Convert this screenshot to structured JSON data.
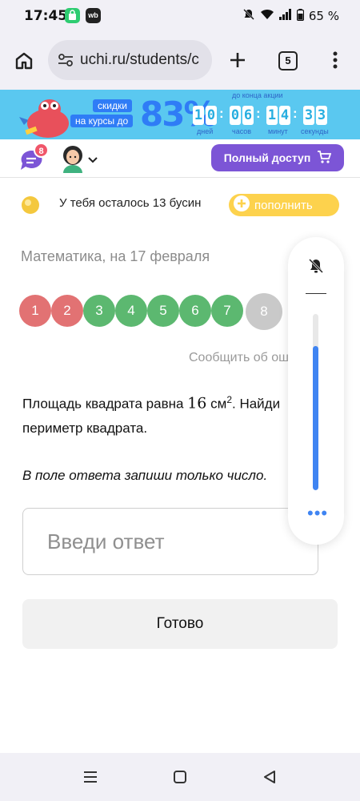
{
  "status_bar": {
    "time": "17:45",
    "app_icons": [
      {
        "icon": "shopping-bag-icon",
        "label": "",
        "color": "#2ecc71"
      },
      {
        "icon": "wildberries-icon",
        "label": "wb",
        "color": "#222222"
      }
    ],
    "icons": [
      "mute-icon",
      "wifi-icon",
      "signal-icon",
      "battery-icon"
    ],
    "battery": "65 %"
  },
  "browser": {
    "url": "uchi.ru/students/c",
    "tabs_count": "5"
  },
  "promo": {
    "tag_line1": "скидки",
    "tag_line2": "на курсы до",
    "percent": "83%",
    "until_label": "до конца акции",
    "timer": {
      "days": [
        "1",
        "0"
      ],
      "hours": [
        "0",
        "6"
      ],
      "minutes": [
        "1",
        "4"
      ],
      "seconds": [
        "3",
        "3"
      ]
    },
    "units": {
      "days": "дней",
      "hours": "часов",
      "minutes": "минут",
      "seconds": "секунды"
    }
  },
  "header": {
    "messages_badge": "8",
    "full_access_label": "Полный доступ"
  },
  "beads": {
    "text": "У тебя осталось 13 бусин",
    "topup_label": "пополнить"
  },
  "lesson_title": "Математика, на 17 февраля",
  "tasks": [
    {
      "n": "1",
      "status": "wrong"
    },
    {
      "n": "2",
      "status": "wrong"
    },
    {
      "n": "3",
      "status": "correct"
    },
    {
      "n": "4",
      "status": "correct"
    },
    {
      "n": "5",
      "status": "correct"
    },
    {
      "n": "6",
      "status": "correct"
    },
    {
      "n": "7",
      "status": "correct"
    },
    {
      "n": "8",
      "status": "current"
    }
  ],
  "task_colors": {
    "wrong": "#e27273",
    "correct": "#5cb870",
    "current": "#c9c9c9"
  },
  "report_link": "Сообщить об ошибке",
  "question": {
    "before": "Площадь квадрата равна ",
    "number": "16",
    "unit": " см",
    "exponent": "2",
    "after": ". Найди периметр квадрата."
  },
  "instruction": "В поле ответа запиши только число.",
  "answer_placeholder": "Введи ответ",
  "done_label": "Готово",
  "side_panel": {
    "bell_icon": "bell-off-icon",
    "volume_level": 0.82,
    "more_icon": "more-dots-icon"
  },
  "nav_bar": [
    "recents-icon",
    "home-icon",
    "back-icon"
  ]
}
